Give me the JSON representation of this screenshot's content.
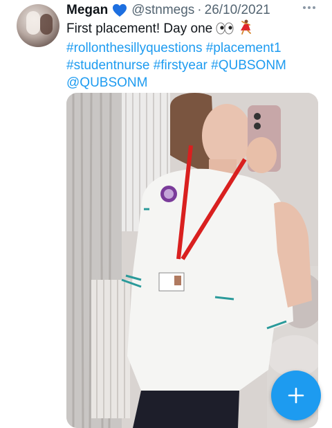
{
  "author": {
    "name": "Megan",
    "badge_icon": "blue-heart-icon",
    "handle": "@stnmegs",
    "separator": "·",
    "date": "26/10/2021"
  },
  "tweet": {
    "line1_text": "First placement! Day one",
    "line1_emojis": [
      "eyes-icon",
      "dancer-icon"
    ],
    "hashtags_line2": [
      "#rollonthesillyquestions",
      "#placement1"
    ],
    "hashtags_line3": [
      "#studentnurse",
      "#firstyear",
      "#QUBSONM"
    ],
    "mention": "@QUBSONM"
  },
  "menu": {
    "icon": "more-options-icon"
  },
  "compose_button": {
    "icon": "plus-icon"
  },
  "colors": {
    "link": "#1d9bf0",
    "secondary_text": "#536471",
    "fab": "#1d9bf0"
  }
}
